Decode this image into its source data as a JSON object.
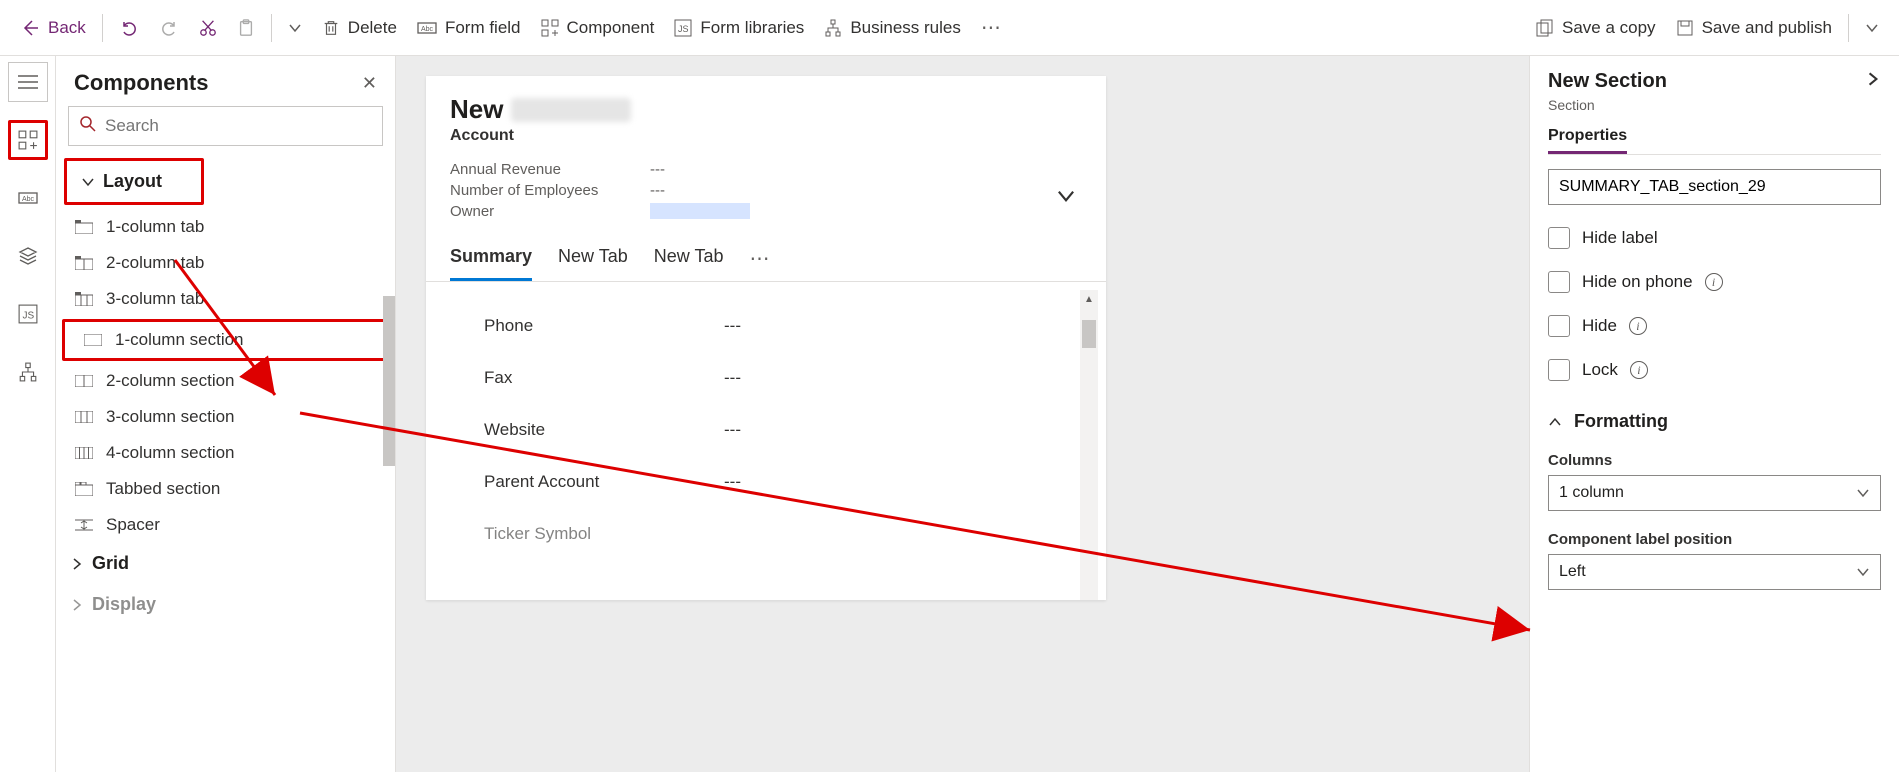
{
  "toolbar": {
    "back": "Back",
    "delete": "Delete",
    "form_field": "Form field",
    "component": "Component",
    "form_libraries": "Form libraries",
    "business_rules": "Business rules",
    "save_copy": "Save a copy",
    "save_publish": "Save and publish"
  },
  "components_panel": {
    "title": "Components",
    "search_placeholder": "Search",
    "layout_header": "Layout",
    "layout_items": [
      "1-column tab",
      "2-column tab",
      "3-column tab",
      "1-column section",
      "2-column section",
      "3-column section",
      "4-column section",
      "Tabbed section",
      "Spacer"
    ],
    "grid_header": "Grid",
    "display_header": "Display"
  },
  "form": {
    "title_prefix": "New",
    "entity": "Account",
    "header_fields": [
      {
        "label": "Annual Revenue",
        "value": "---"
      },
      {
        "label": "Number of Employees",
        "value": "---"
      },
      {
        "label": "Owner",
        "value": ""
      }
    ],
    "tabs": [
      "Summary",
      "New Tab",
      "New Tab"
    ],
    "active_tab": 0,
    "section_fields": [
      {
        "label": "Phone",
        "value": "---"
      },
      {
        "label": "Fax",
        "value": "---"
      },
      {
        "label": "Website",
        "value": "---"
      },
      {
        "label": "Parent Account",
        "value": "---"
      },
      {
        "label": "Ticker Symbol",
        "value": ""
      }
    ]
  },
  "properties": {
    "title": "New Section",
    "subtitle": "Section",
    "tab": "Properties",
    "name_value": "SUMMARY_TAB_section_29",
    "checks": {
      "hide_label": "Hide label",
      "hide_phone": "Hide on phone",
      "hide": "Hide",
      "lock": "Lock"
    },
    "formatting_header": "Formatting",
    "columns_label": "Columns",
    "columns_value": "1 column",
    "label_pos_label": "Component label position",
    "label_pos_value": "Left"
  }
}
